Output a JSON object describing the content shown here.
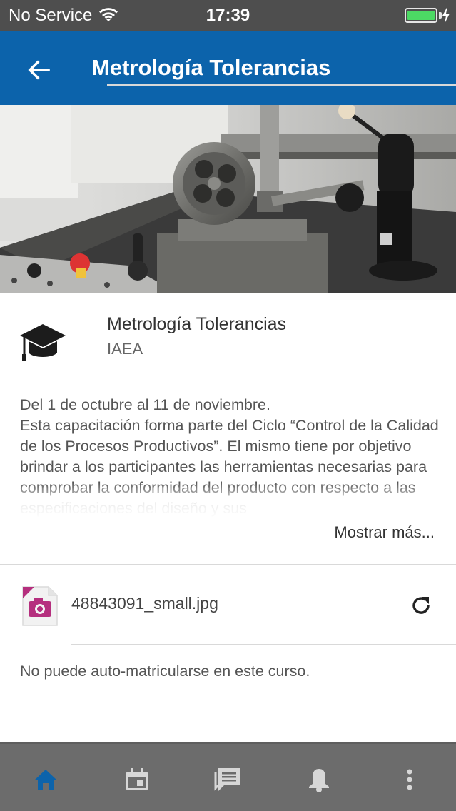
{
  "status_bar": {
    "carrier": "No Service",
    "time": "17:39",
    "battery_color": "#4cd964"
  },
  "header": {
    "title": "Metrología Tolerancias",
    "back_icon": "arrow-left-icon",
    "background_color": "#0c63ab"
  },
  "course": {
    "name": "Metrología Tolerancias",
    "organization": "IAEA",
    "icon": "graduation-cap-icon"
  },
  "description": {
    "dates": "Del 1 de octubre al 11 de noviembre.",
    "text": "Esta capacitación forma parte del Ciclo “Control de la Calidad de los Procesos Productivos”. El mismo tiene por objetivo brindar a los participantes las herramientas necesarias para comprobar la conformidad del producto con respecto a las especificaciones del diseño y sus",
    "show_more": "Mostrar más..."
  },
  "file": {
    "name": "48843091_small.jpg",
    "icon": "image-file-icon",
    "action_icon": "refresh-icon"
  },
  "enrolment": {
    "message": "No puede auto-matricularse en este curso."
  },
  "bottom_nav": {
    "items": [
      {
        "icon": "home-icon",
        "active": true
      },
      {
        "icon": "calendar-icon",
        "active": false
      },
      {
        "icon": "messages-icon",
        "active": false
      },
      {
        "icon": "bell-icon",
        "active": false
      },
      {
        "icon": "more-vertical-icon",
        "active": false
      }
    ],
    "active_color": "#0c63ab"
  }
}
